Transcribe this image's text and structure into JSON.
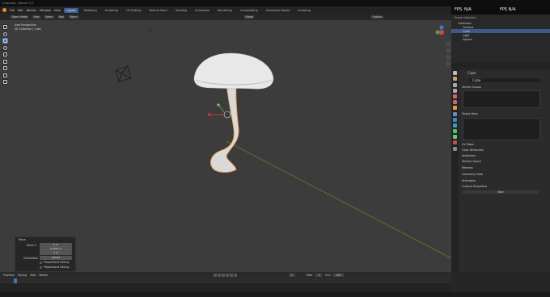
{
  "window": {
    "title": "(Unsaved) - Blender 3.3"
  },
  "menu": [
    "File",
    "Edit",
    "Render",
    "Window",
    "Help"
  ],
  "workspaces": [
    {
      "label": "Layout",
      "active": true
    },
    {
      "label": "Modeling",
      "active": false
    },
    {
      "label": "Sculpting",
      "active": false
    },
    {
      "label": "UV Editing",
      "active": false
    },
    {
      "label": "Texture Paint",
      "active": false
    },
    {
      "label": "Shading",
      "active": false
    },
    {
      "label": "Animation",
      "active": false
    },
    {
      "label": "Rendering",
      "active": false
    },
    {
      "label": "Compositing",
      "active": false
    },
    {
      "label": "Geometry Nodes",
      "active": false
    },
    {
      "label": "Scripting",
      "active": false
    }
  ],
  "header": {
    "mode": "Object Mode",
    "view": "View",
    "select": "Select",
    "add": "Add",
    "object": "Object",
    "transform": "Global",
    "options": "Options"
  },
  "viewport": {
    "overlay_line1": "User Perspective",
    "overlay_line2": "(0) Collection | Cube"
  },
  "hud": {
    "fps_label": "FPS",
    "fps_value": "N/A",
    "extra": "FPS N/A"
  },
  "outliner": {
    "title": "Scene Collection",
    "rows": [
      {
        "label": "Collection",
        "selected": false
      },
      {
        "label": "Camera",
        "selected": false
      },
      {
        "label": "Cube",
        "selected": true
      },
      {
        "label": "Light",
        "selected": false
      },
      {
        "label": "Sphere",
        "selected": false
      }
    ]
  },
  "properties": {
    "object_name": "Cube",
    "data_name": "Cube",
    "sections": [
      "Vertex Groups",
      "Shape Keys",
      "UV Maps",
      "Color Attributes",
      "Attributes",
      "Texture Space",
      "Remesh",
      "Geometry Data",
      "Animation",
      "Custom Properties"
    ],
    "new_button": "New"
  },
  "operator_panel": {
    "title": "Move",
    "move_label": "Move X",
    "move_values": [
      "0 m",
      "0.0093 m",
      "0 m"
    ],
    "orientation_label": "Orientation",
    "orientation_value": "Global",
    "proportional_label": "Proportional Editing",
    "falloff_label": "Proportional Editing"
  },
  "timeline": {
    "playback": "Playback",
    "keying": "Keying",
    "view": "View",
    "marker": "Marker",
    "current_frame": "1",
    "start_label": "Start",
    "start": "1",
    "end_label": "End",
    "end": "250"
  }
}
